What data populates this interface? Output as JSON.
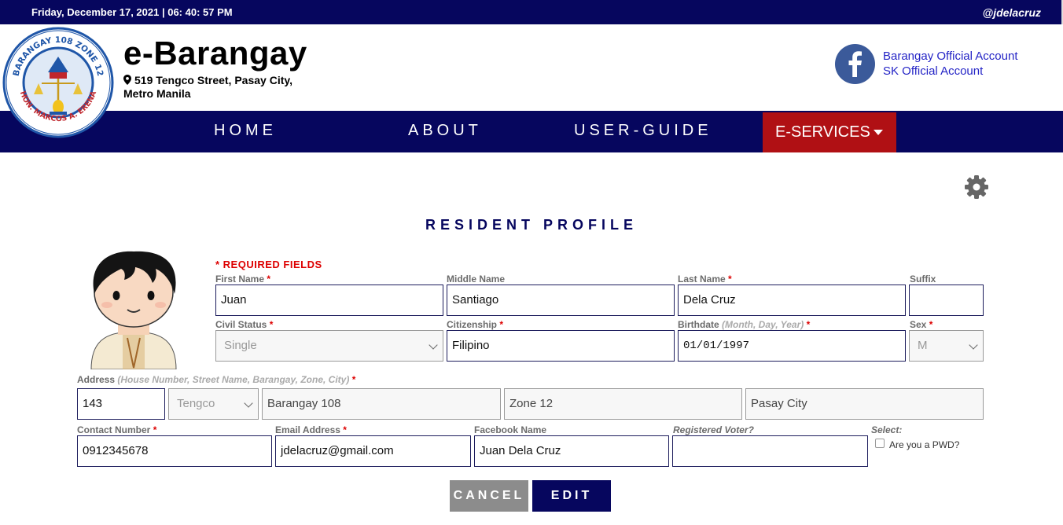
{
  "topbar": {
    "datetime": "Friday, December 17, 2021 | 06: 40: 57 PM",
    "handle": "@jdelacruz"
  },
  "brand": {
    "title": "e-Barangay",
    "address_line1": "519 Tengco Street, Pasay City,",
    "address_line2": "Metro Manila",
    "logo_top_text": "BARANGAY 108 ZONE 12",
    "logo_bottom_text": "HON. MARCOS A. ERENA"
  },
  "social": {
    "link1": "Barangay Official Account",
    "link2": "SK Official Account"
  },
  "nav": {
    "home": "HOME",
    "about": "ABOUT",
    "guide": "USER-GUIDE",
    "eservices": "E-SERVICES"
  },
  "page": {
    "title": "RESIDENT PROFILE",
    "required_note": "* REQUIRED FIELDS"
  },
  "labels": {
    "first_name": "First Name",
    "middle_name": "Middle Name",
    "last_name": "Last Name",
    "suffix": "Suffix",
    "civil_status": "Civil Status",
    "citizenship": "Citizenship",
    "birthdate": "Birthdate",
    "birthdate_hint": "(Month, Day, Year)",
    "sex": "Sex",
    "address": "Address",
    "address_hint": "(House Number, Street Name, Barangay, Zone, City)",
    "contact": "Contact Number",
    "email": "Email Address",
    "facebook": "Facebook Name",
    "voter": "Registered Voter?",
    "select": "Select:",
    "pwd": "Are you a PWD?",
    "star": "*"
  },
  "values": {
    "first_name": "Juan",
    "middle_name": "Santiago",
    "last_name": "Dela Cruz",
    "suffix": "",
    "civil_status": "Single",
    "citizenship": "Filipino",
    "birthdate": "01/01/1997",
    "sex": "M",
    "house_no": "143",
    "street": "Tengco",
    "barangay": "Barangay 108",
    "zone": "Zone 12",
    "city": "Pasay City",
    "contact": "0912345678",
    "email": "jdelacruz@gmail.com",
    "facebook": "Juan Dela Cruz",
    "voter": "",
    "pwd_checked": false
  },
  "buttons": {
    "cancel": "CANCEL",
    "edit": "EDIT"
  },
  "colors": {
    "navy": "#06065e",
    "red": "#b01014",
    "required": "#dd0000",
    "link": "#2424c6"
  },
  "icons": {
    "location": "map-marker-icon",
    "facebook": "facebook-icon",
    "settings": "gear-icon",
    "dropdown": "caret-down-icon"
  }
}
